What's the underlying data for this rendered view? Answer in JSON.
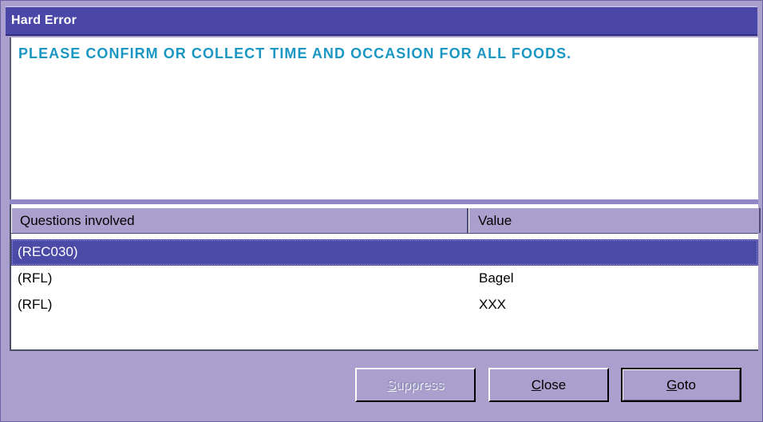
{
  "window": {
    "title": "Hard Error"
  },
  "message": {
    "text": "PLEASE CONFIRM OR COLLECT TIME AND OCCASION FOR ALL FOODS."
  },
  "list": {
    "columns": [
      "Questions involved",
      "Value"
    ],
    "rows": [
      {
        "question": "(REC030)",
        "value": "",
        "selected": true
      },
      {
        "question": "(RFL)",
        "value": "Bagel",
        "selected": false
      },
      {
        "question": "(RFL)",
        "value": "XXX",
        "selected": false
      }
    ]
  },
  "buttons": {
    "suppress": {
      "mnemonic": "S",
      "rest": "uppress",
      "enabled": false
    },
    "close": {
      "mnemonic": "C",
      "rest": "lose",
      "enabled": true
    },
    "goto": {
      "mnemonic": "G",
      "rest": "oto",
      "enabled": true,
      "default": true
    }
  },
  "colors": {
    "titlebar": "#4b47a8",
    "window_bg": "#ab9fcd",
    "message_text": "#1b97c3",
    "selection": "#4c4aa7"
  }
}
